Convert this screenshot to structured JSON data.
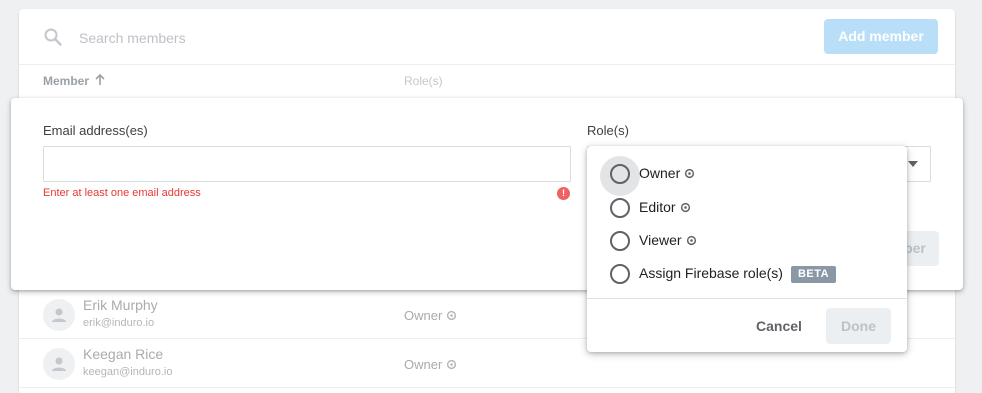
{
  "members_list": {
    "search_placeholder": "Search members",
    "add_member_label": "Add member",
    "column_member": "Member",
    "column_roles": "Role(s)",
    "members": [
      {
        "name": "Erik Murphy",
        "email": "erik@induro.io",
        "role": "Owner"
      },
      {
        "name": "Keegan Rice",
        "email": "keegan@induro.io",
        "role": "Owner"
      }
    ]
  },
  "dialog": {
    "email_label": "Email address(es)",
    "email_value": "",
    "email_error": "Enter at least one email address",
    "error_icon": "!",
    "roles_label": "Role(s)",
    "add_member_partial_label": "ber"
  },
  "role_menu": {
    "options": [
      {
        "label": "Owner",
        "icon": "gear-icon",
        "selected": false
      },
      {
        "label": "Editor",
        "icon": "gear-icon",
        "selected": false
      },
      {
        "label": "Viewer",
        "icon": "gear-icon",
        "selected": false
      },
      {
        "label": "Assign Firebase role(s)",
        "badge": "BETA",
        "selected": false
      }
    ],
    "cancel_label": "Cancel",
    "done_label": "Done"
  },
  "colors": {
    "accent_disabled": "#b9def8",
    "error": "#e53935",
    "badge": "#8a98a6"
  }
}
